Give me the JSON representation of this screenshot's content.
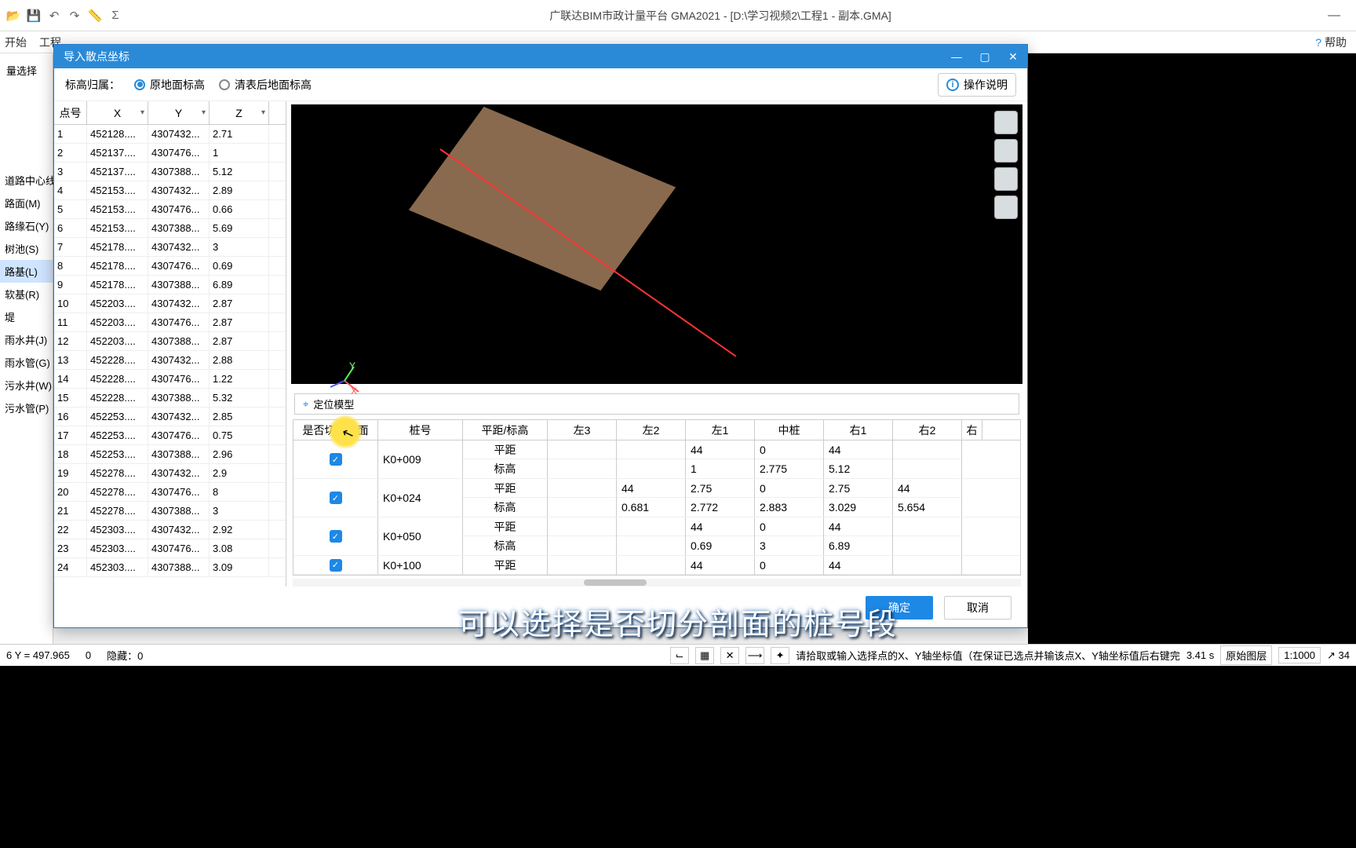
{
  "app": {
    "title": "广联达BIM市政计量平台 GMA2021 - [D:\\学习视频2\\工程1 - 副本.GMA]"
  },
  "menu": {
    "items": [
      "开始",
      "工程"
    ],
    "help": "帮助"
  },
  "left_panel": {
    "sel": "量选择",
    "tree": [
      {
        "label": "道路中心线",
        "sel": false
      },
      {
        "label": "路面(M)",
        "sel": false
      },
      {
        "label": "路缘石(Y)",
        "sel": false
      },
      {
        "label": "树池(S)",
        "sel": false
      },
      {
        "label": "路基(L)",
        "sel": true
      },
      {
        "label": "软基(R)",
        "sel": false
      },
      {
        "label": "堤",
        "sel": false
      },
      {
        "label": "雨水井(J)",
        "sel": false
      },
      {
        "label": "雨水管(G)",
        "sel": false
      },
      {
        "label": "污水井(W)",
        "sel": false
      },
      {
        "label": "污水管(P)",
        "sel": false
      }
    ]
  },
  "modal": {
    "title": "导入散点坐标",
    "elev_label": "标高归属：",
    "radio1": "原地面标高",
    "radio2": "清表后地面标高",
    "help": "操作说明",
    "table_head": {
      "c1": "点号",
      "c2": "X",
      "c3": "Y",
      "c4": "Z"
    },
    "rows": [
      {
        "n": "1",
        "x": "452128....",
        "y": "4307432...",
        "z": "2.71"
      },
      {
        "n": "2",
        "x": "452137....",
        "y": "4307476...",
        "z": "1"
      },
      {
        "n": "3",
        "x": "452137....",
        "y": "4307388...",
        "z": "5.12"
      },
      {
        "n": "4",
        "x": "452153....",
        "y": "4307432...",
        "z": "2.89"
      },
      {
        "n": "5",
        "x": "452153....",
        "y": "4307476...",
        "z": "0.66"
      },
      {
        "n": "6",
        "x": "452153....",
        "y": "4307388...",
        "z": "5.69"
      },
      {
        "n": "7",
        "x": "452178....",
        "y": "4307432...",
        "z": "3"
      },
      {
        "n": "8",
        "x": "452178....",
        "y": "4307476...",
        "z": "0.69"
      },
      {
        "n": "9",
        "x": "452178....",
        "y": "4307388...",
        "z": "6.89"
      },
      {
        "n": "10",
        "x": "452203....",
        "y": "4307432...",
        "z": "2.87"
      },
      {
        "n": "11",
        "x": "452203....",
        "y": "4307476...",
        "z": "2.87"
      },
      {
        "n": "12",
        "x": "452203....",
        "y": "4307388...",
        "z": "2.87"
      },
      {
        "n": "13",
        "x": "452228....",
        "y": "4307432...",
        "z": "2.88"
      },
      {
        "n": "14",
        "x": "452228....",
        "y": "4307476...",
        "z": "1.22"
      },
      {
        "n": "15",
        "x": "452228....",
        "y": "4307388...",
        "z": "5.32"
      },
      {
        "n": "16",
        "x": "452253....",
        "y": "4307432...",
        "z": "2.85"
      },
      {
        "n": "17",
        "x": "452253....",
        "y": "4307476...",
        "z": "0.75"
      },
      {
        "n": "18",
        "x": "452253....",
        "y": "4307388...",
        "z": "2.96"
      },
      {
        "n": "19",
        "x": "452278....",
        "y": "4307432...",
        "z": "2.9"
      },
      {
        "n": "20",
        "x": "452278....",
        "y": "4307476...",
        "z": "8"
      },
      {
        "n": "21",
        "x": "452278....",
        "y": "4307388...",
        "z": "3"
      },
      {
        "n": "22",
        "x": "452303....",
        "y": "4307432...",
        "z": "2.92"
      },
      {
        "n": "23",
        "x": "452303....",
        "y": "4307476...",
        "z": "3.08"
      },
      {
        "n": "24",
        "x": "452303....",
        "y": "4307388...",
        "z": "3.09"
      }
    ],
    "axis": {
      "x": "X",
      "y": "Y"
    },
    "locate": "定位模型",
    "sec_head": {
      "a": "是否切分剖面",
      "b": "桩号",
      "c": "平距/标高",
      "d": "左3",
      "e": "左2",
      "f": "左1",
      "g": "中桩",
      "h": "右1",
      "i": "右2",
      "j": "右"
    },
    "sub_labels": {
      "pd": "平距",
      "bg": "标高"
    },
    "sections": [
      {
        "chk": true,
        "stn": "K0+009",
        "l3": [
          "",
          ""
        ],
        "l2": [
          "",
          ""
        ],
        "l1": [
          "44",
          "1"
        ],
        "mid": [
          "0",
          "2.775"
        ],
        "r1": [
          "44",
          "5.12"
        ],
        "r2": [
          "",
          ""
        ]
      },
      {
        "chk": true,
        "stn": "K0+024",
        "l3": [
          "",
          ""
        ],
        "l2": [
          "44",
          "0.681"
        ],
        "l1": [
          "2.75",
          "2.772"
        ],
        "mid": [
          "0",
          "2.883"
        ],
        "r1": [
          "2.75",
          "3.029"
        ],
        "r2": [
          "44",
          "5.654"
        ]
      },
      {
        "chk": true,
        "stn": "K0+050",
        "l3": [
          "",
          ""
        ],
        "l2": [
          "",
          ""
        ],
        "l1": [
          "44",
          "0.69"
        ],
        "mid": [
          "0",
          "3"
        ],
        "r1": [
          "44",
          "6.89"
        ],
        "r2": [
          "",
          ""
        ]
      },
      {
        "chk": true,
        "stn": "K0+100",
        "l3": [
          "",
          ""
        ],
        "l2": [
          "",
          ""
        ],
        "l1": [
          "44",
          ""
        ],
        "mid": [
          "0",
          ""
        ],
        "r1": [
          "44",
          ""
        ],
        "r2": [
          "",
          ""
        ]
      }
    ],
    "ok": "确定",
    "cancel": "取消"
  },
  "subtitle": "可以选择是否切分剖面的桩号段",
  "status": {
    "coord": "6 Y = 497.965",
    "zero": "0",
    "hidden": "隐藏：0",
    "hint": "请拾取或输入选择点的X、Y轴坐标值（在保证已选点并输该点X、Y轴坐标值后右键完",
    "time": "3.41 s",
    "layer": "原始图层",
    "scale": "1:1000",
    "count": "34"
  }
}
